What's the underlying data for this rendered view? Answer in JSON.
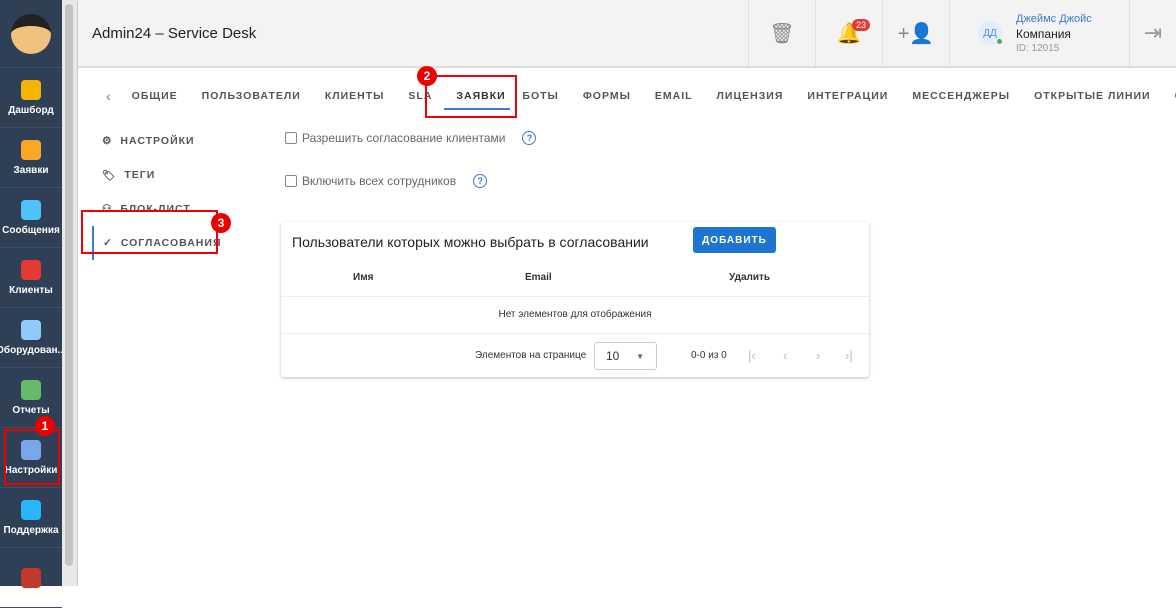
{
  "app": {
    "title": "Admin24 – Service Desk"
  },
  "sidebar": {
    "items": [
      {
        "label": "Дашборд",
        "color": "#f4b400"
      },
      {
        "label": "Заявки",
        "color": "#f9a825"
      },
      {
        "label": "Сообщения",
        "color": "#4fc3f7"
      },
      {
        "label": "Клиенты",
        "color": "#e53935"
      },
      {
        "label": "Оборудован...",
        "color": "#90caf9"
      },
      {
        "label": "Отчеты",
        "color": "#66bb6a"
      },
      {
        "label": "Настройки",
        "color": "#7aa7e8"
      },
      {
        "label": "Поддержка",
        "color": "#29b6f6"
      }
    ]
  },
  "header": {
    "notifications": "23",
    "user_name": "Джеймс Джойс",
    "initials": "ДД",
    "company": "Компания",
    "user_id": "ID: 12015"
  },
  "tabs": [
    "ОБЩИЕ",
    "ПОЛЬЗОВАТЕЛИ",
    "КЛИЕНТЫ",
    "SLA",
    "ЗАЯВКИ",
    "БОТЫ",
    "ФОРМЫ",
    "EMAIL",
    "ЛИЦЕНЗИЯ",
    "ИНТЕГРАЦИИ",
    "МЕССЕНДЖЕРЫ",
    "ОТКРЫТЫЕ ЛИНИИ",
    "ОБОІ"
  ],
  "subnav": [
    "НАСТРОЙКИ",
    "ТЕГИ",
    "БЛОК-ЛИСТ",
    "СОГЛАСОВАНИЯ"
  ],
  "options": {
    "allow_clients": "Разрешить согласование клиентами",
    "include_all": "Включить всех сотрудников"
  },
  "card": {
    "title": "Пользователи которых можно выбрать в согласовании",
    "add": "ДОБАВИТЬ",
    "columns": [
      "Имя",
      "Email",
      "Удалить"
    ],
    "empty": "Нет элементов для отображения",
    "per_page_label": "Элементов на странице",
    "per_page": "10",
    "range": "0-0 из 0"
  },
  "annotations": [
    "1",
    "2",
    "3"
  ]
}
